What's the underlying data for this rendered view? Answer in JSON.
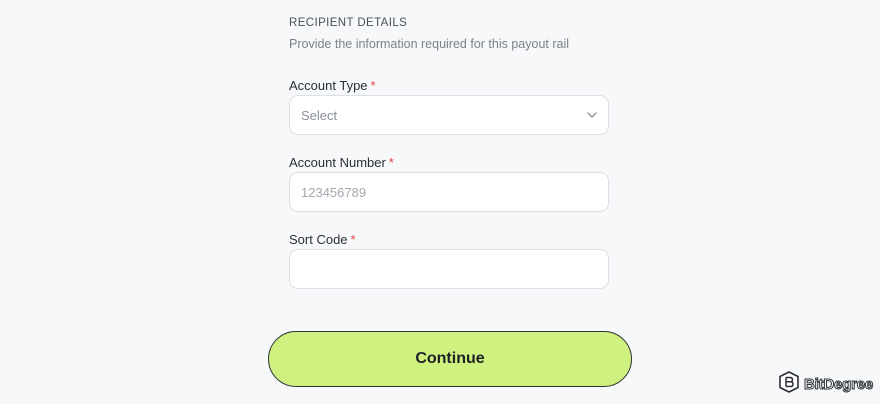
{
  "section": {
    "title": "RECIPIENT DETAILS",
    "subtitle": "Provide the information required for this payout rail"
  },
  "fields": {
    "account_type": {
      "label": "Account Type",
      "required_mark": "*",
      "value": "Select",
      "icon": "chevron-down-icon"
    },
    "account_number": {
      "label": "Account Number",
      "required_mark": "*",
      "placeholder": "123456789"
    },
    "sort_code": {
      "label": "Sort Code",
      "required_mark": "*",
      "value": ""
    }
  },
  "actions": {
    "continue_label": "Continue"
  },
  "watermark": {
    "text": "BitDegree",
    "icon": "bitdegree-logo-icon"
  },
  "colors": {
    "background": "#f7f8fa",
    "button": "#cff17f",
    "required": "#e5484d"
  }
}
